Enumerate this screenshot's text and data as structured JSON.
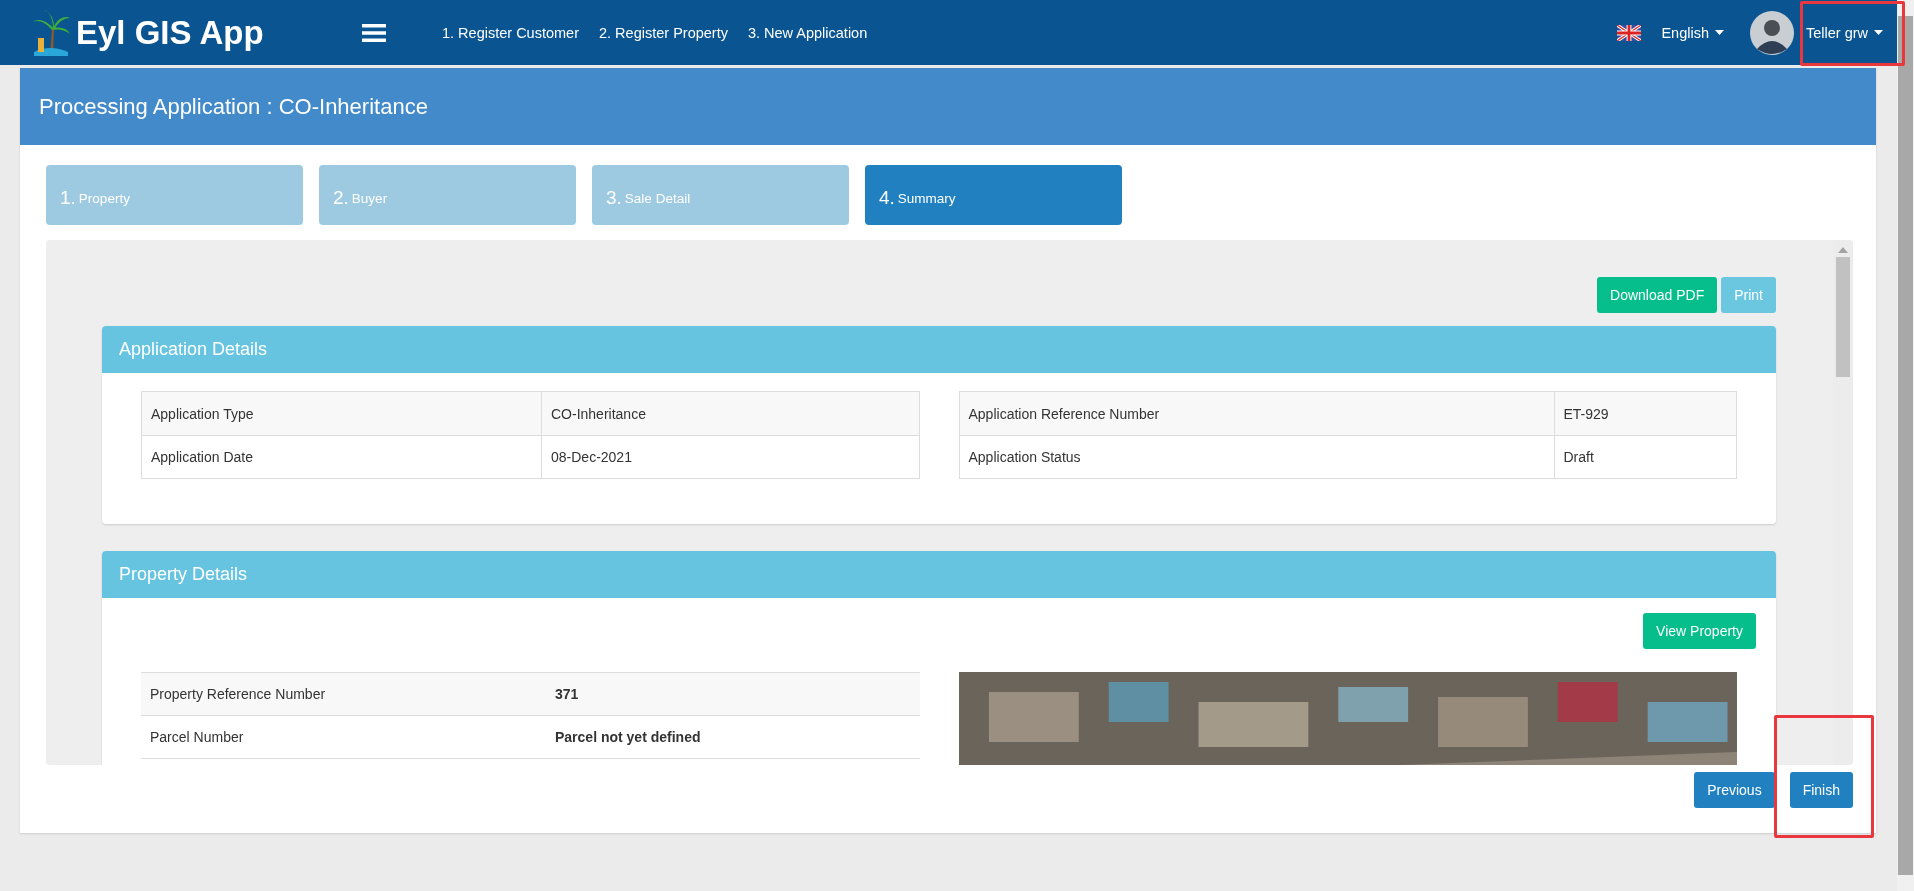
{
  "header": {
    "logo": "Eyl GIS App",
    "nav": [
      "1. Register Customer",
      "2. Register Property",
      "3. New Application"
    ],
    "language": "English",
    "user": {
      "name": "Teller grw",
      "highlighted": true
    }
  },
  "page_title": "Processing Application : CO-Inheritance",
  "steps": [
    {
      "number": "1.",
      "label": "Property",
      "selected": false
    },
    {
      "number": "2.",
      "label": "Buyer",
      "selected": false
    },
    {
      "number": "3.",
      "label": "Sale Detail",
      "selected": false
    },
    {
      "number": "4.",
      "label": "Summary",
      "selected": true
    }
  ],
  "actions": [
    {
      "label": "Download PDF",
      "kind": "success"
    },
    {
      "label": "Print",
      "kind": "info"
    }
  ],
  "application_details": {
    "title": "Application Details",
    "tables": [
      [
        {
          "label": "Application Type",
          "value": "CO-Inheritance"
        },
        {
          "label": "Application Date",
          "value": "08-Dec-2021"
        }
      ],
      [
        {
          "label": "Application Reference Number",
          "value": "ET-929"
        },
        {
          "label": "Application Status",
          "value": "Draft"
        }
      ]
    ]
  },
  "property_details": {
    "title": "Property Details",
    "button": "View Property",
    "rows": [
      {
        "label": "Property Reference Number",
        "value": "371"
      },
      {
        "label": "Parcel Number",
        "value": "Parcel not yet defined"
      }
    ]
  },
  "footer_buttons": [
    {
      "label": "Previous",
      "highlighted": false
    },
    {
      "label": "Finish",
      "highlighted": true
    }
  ]
}
